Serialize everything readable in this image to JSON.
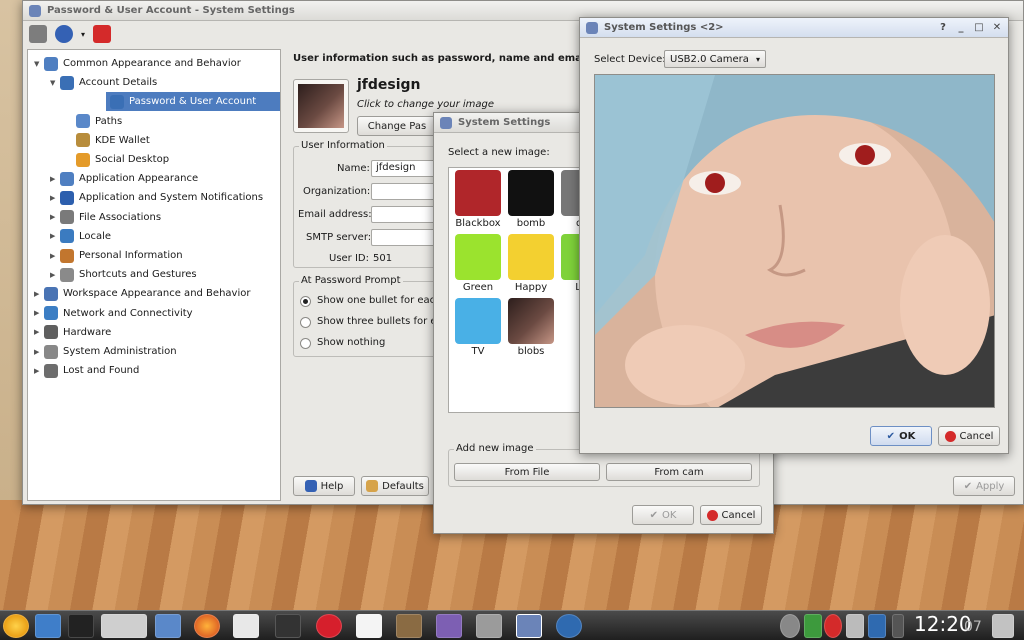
{
  "main_window": {
    "title": "Password & User Account - System Settings",
    "titlebar_buttons": [
      "?",
      "_",
      "□",
      "✕"
    ],
    "tree": [
      {
        "label": "Common Appearance and Behavior",
        "level": 0,
        "expanded": true,
        "icon": "appearance-icon"
      },
      {
        "label": "Account Details",
        "level": 1,
        "expanded": true,
        "icon": "user-icon"
      },
      {
        "label": "Password & User Account",
        "level": 2,
        "selected": true,
        "icon": "user-icon"
      },
      {
        "label": "Paths",
        "level": 2,
        "icon": "folder-icon"
      },
      {
        "label": "KDE Wallet",
        "level": 2,
        "icon": "wallet-icon"
      },
      {
        "label": "Social Desktop",
        "level": 2,
        "icon": "star-icon"
      },
      {
        "label": "Application Appearance",
        "level": 1,
        "icon": "appearance-icon"
      },
      {
        "label": "Application and System Notifications",
        "level": 1,
        "icon": "notification-icon"
      },
      {
        "label": "File Associations",
        "level": 1,
        "icon": "file-icon"
      },
      {
        "label": "Locale",
        "level": 1,
        "icon": "globe-icon"
      },
      {
        "label": "Personal Information",
        "level": 1,
        "icon": "person-icon"
      },
      {
        "label": "Shortcuts and Gestures",
        "level": 1,
        "icon": "keyboard-icon"
      },
      {
        "label": "Workspace Appearance and Behavior",
        "level": 0,
        "icon": "workspace-icon"
      },
      {
        "label": "Network and Connectivity",
        "level": 0,
        "icon": "network-icon"
      },
      {
        "label": "Hardware",
        "level": 0,
        "icon": "hardware-icon"
      },
      {
        "label": "System Administration",
        "level": 0,
        "icon": "tools-icon"
      },
      {
        "label": "Lost and Found",
        "level": 0,
        "icon": "gear-icon"
      }
    ],
    "header": "User information such as password, name and email",
    "username": "jfdesign",
    "change_image_hint": "Click to change your image",
    "change_password_label": "Change Pas",
    "user_info": {
      "group_title": "User Information",
      "name_label": "Name:",
      "name_value": "jfdesign",
      "organization_label": "Organization:",
      "email_label": "Email address:",
      "smtp_label": "SMTP server:",
      "uid_label": "User ID:",
      "uid_value": "501"
    },
    "password_prompt": {
      "group_title": "At Password Prompt",
      "options": [
        "Show one bullet for each",
        "Show three bullets for ea",
        "Show nothing"
      ],
      "selected": 0
    },
    "help_label": "Help",
    "defaults_label": "Defaults",
    "apply_label": "Apply"
  },
  "image_dialog": {
    "title": "System Settings",
    "prompt": "Select a new image:",
    "images": [
      {
        "label": "Blackbox",
        "color": "#b0262a"
      },
      {
        "label": "bomb",
        "color": "#111111"
      },
      {
        "label": "def",
        "color": "#777777"
      },
      {
        "label": "Green",
        "color": "#9be32e"
      },
      {
        "label": "Happy",
        "color": "#f3d030"
      },
      {
        "label": "List",
        "color": "#7fd23a"
      },
      {
        "label": "TV",
        "color": "#49b0e6"
      },
      {
        "label": "blobs",
        "color": "#5a3a34"
      }
    ],
    "add_group_title": "Add new image",
    "from_file_label": "From File",
    "from_cam_label": "From cam",
    "ok_label": "OK",
    "cancel_label": "Cancel"
  },
  "camera_dialog": {
    "title": "System Settings <2>",
    "device_label": "Select Device:",
    "device_value": "USB2.0 Camera",
    "ok_label": "OK",
    "cancel_label": "Cancel"
  },
  "taskbar": {
    "clock": "12:20",
    "clock_seconds": "07"
  }
}
